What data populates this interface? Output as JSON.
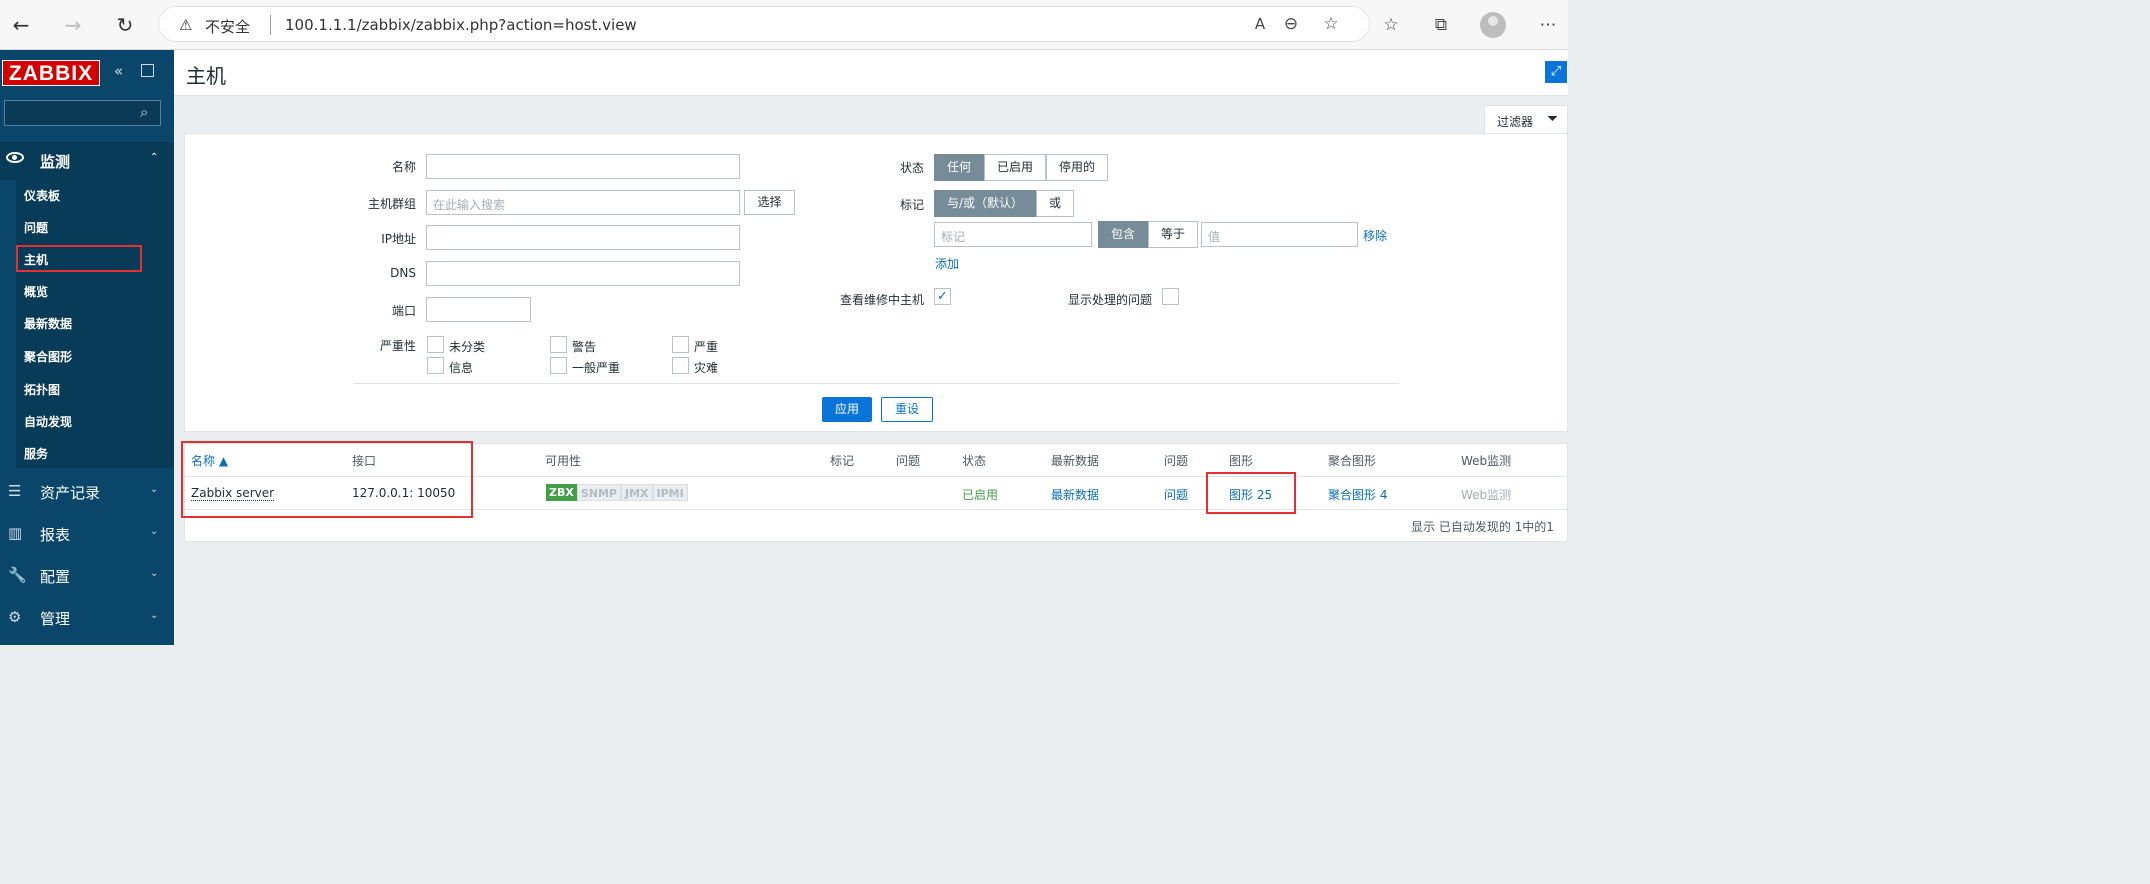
{
  "browser": {
    "security_label": "不安全",
    "url": "100.1.1.1/zabbix/zabbix.php?action=host.view"
  },
  "sidebar": {
    "logo": "ZABBIX",
    "search_placeholder": "",
    "sections": [
      {
        "label": "监测",
        "icon": "eye-icon",
        "expanded": true
      },
      {
        "label": "资产记录",
        "icon": "list-icon"
      },
      {
        "label": "报表",
        "icon": "bar-chart-icon"
      },
      {
        "label": "配置",
        "icon": "wrench-icon"
      },
      {
        "label": "管理",
        "icon": "cog-icon"
      }
    ],
    "monitoring_items": [
      "仪表板",
      "问题",
      "主机",
      "概览",
      "最新数据",
      "聚合图形",
      "拓扑图",
      "自动发现",
      "服务"
    ]
  },
  "page": {
    "title": "主机"
  },
  "filter": {
    "tab_label": "过滤器",
    "name_label": "名称",
    "hostgroup_label": "主机群组",
    "hostgroup_placeholder": "在此输入搜索",
    "select_button": "选择",
    "ip_label": "IP地址",
    "dns_label": "DNS",
    "port_label": "端口",
    "severity_label": "严重性",
    "severities": [
      "未分类",
      "警告",
      "严重",
      "信息",
      "一般严重",
      "灾难"
    ],
    "status_label": "状态",
    "status_options": [
      "任何",
      "已启用",
      "停用的"
    ],
    "tags_label": "标记",
    "tag_ops": [
      "与/或（默认）",
      "或"
    ],
    "tag_placeholder": "标记",
    "tag_match": [
      "包含",
      "等于"
    ],
    "value_placeholder": "值",
    "remove": "移除",
    "add": "添加",
    "maintenance_label": "查看维修中主机",
    "suppressed_label": "显示处理的问题",
    "apply": "应用",
    "reset": "重设"
  },
  "table": {
    "headers": [
      "名称 ▲",
      "接口",
      "可用性",
      "标记",
      "问题",
      "状态",
      "最新数据",
      "问题",
      "图形",
      "聚合图形",
      "Web监测"
    ],
    "rows": [
      {
        "name": "Zabbix server",
        "interface": "127.0.0.1: 10050",
        "availability": [
          "ZBX",
          "SNMP",
          "JMX",
          "IPMI"
        ],
        "status": "已启用",
        "latest_data": "最新数据",
        "problems": "问题",
        "graphs": "图形 25",
        "screens": "聚合图形 4",
        "web": "Web监测"
      }
    ],
    "footer": "显示 已自动发现的 1中的1"
  },
  "colors": {
    "accent": "#0b74d9",
    "sidebar": "#0a466a",
    "logo": "#d40000",
    "enabled": "#429e47",
    "highlight": "#e53030"
  }
}
